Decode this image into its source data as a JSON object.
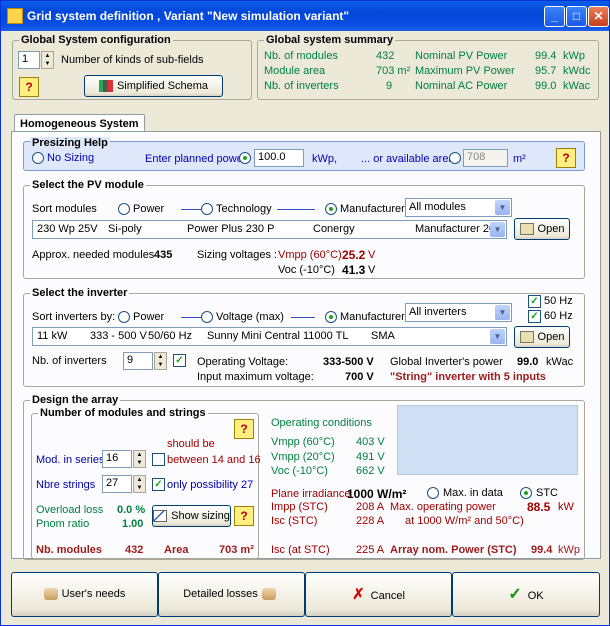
{
  "window": {
    "title": "Grid system definition , Variant  \"New simulation variant\"",
    "min": "_",
    "max": "□",
    "close": "✕"
  },
  "global_config": {
    "title": "Global System configuration",
    "subfields_value": "1",
    "subfields_label": "Number of kinds of sub-fields",
    "help": "?",
    "schema_button": "Simplified Schema"
  },
  "summary": {
    "title": "Global system summary",
    "rows": [
      {
        "label": "Nb. of modules",
        "value": "432",
        "label2": "Nominal PV Power",
        "value2": "99.4",
        "unit2": "kWp"
      },
      {
        "label": "Module area",
        "value": "703 m²",
        "label2": "Maximum PV Power",
        "value2": "95.7",
        "unit2": "kWdc"
      },
      {
        "label": "Nb. of inverters",
        "value": "9",
        "label2": "Nominal AC Power",
        "value2": "99.0",
        "unit2": "kWac"
      }
    ]
  },
  "tab": "Homogeneous System",
  "presizing": {
    "title": "Presizing Help",
    "no_sizing": "No Sizing",
    "planned_label": "Enter planned power",
    "planned_value": "100.0",
    "planned_unit": "kWp,",
    "area_label": "... or available area",
    "area_value": "708",
    "area_unit": "m²",
    "help": "?"
  },
  "pv": {
    "title": "Select the PV module",
    "sort_label": "Sort modules",
    "opt_power": "Power",
    "opt_tech": "Technology",
    "opt_manu": "Manufacturer",
    "filter": "All modules",
    "module": {
      "c1": "230 Wp 25V",
      "c2": "Si-poly",
      "c3": "Power Plus 230 P",
      "c4": "Conergy",
      "c5": "Manufacturer 20("
    },
    "open": "Open",
    "approx_label": "Approx. needed modules",
    "approx_value": "435",
    "sizing_label": "Sizing voltages :",
    "vmpp_label": "Vmpp (60°C)",
    "vmpp_value": "25.2",
    "vmpp_unit": "V",
    "voc_label": "Voc  (-10°C)",
    "voc_value": "41.3",
    "voc_unit": "V"
  },
  "inverter": {
    "title": "Select the inverter",
    "sort_label": "Sort inverters by:",
    "opt_power": "Power",
    "opt_voltage": "Voltage (max)",
    "opt_manu": "Manufacturer",
    "filter": "All inverters",
    "hz50": "50 Hz",
    "hz60": "60 Hz",
    "inv": {
      "c1": "11 kW",
      "c2": "333 - 500 V",
      "c3": "50/60 Hz",
      "c4": "Sunny Mini Central 11000 TL",
      "c5": "SMA"
    },
    "open": "Open",
    "nb_label": "Nb. of inverters",
    "nb_value": "9",
    "opv_label": "Operating Voltage:",
    "opv_value": "333-500 V",
    "max_in_label": "Input maximum voltage:",
    "max_in_value": "700 V",
    "global_label": "Global Inverter's power",
    "global_value": "99.0",
    "global_unit": "kWac",
    "string_note": "\"String\" inverter with 5 inputs"
  },
  "array": {
    "title": "Design the array",
    "ms_title": "Number of modules and strings",
    "help": "?",
    "should_be": "should be",
    "series_label": "Mod. in series",
    "series_value": "16",
    "between": "between 14 and 16",
    "strings_label": "Nbre strings",
    "strings_value": "27",
    "only": "only possibility 27",
    "overload_label": "Overload loss",
    "overload_value": "0.0 %",
    "pnom_label": "Pnom ratio",
    "pnom_value": "1.00",
    "show_sizing": "Show sizing",
    "help2": "?",
    "nb_mod_label": "Nb. modules",
    "nb_mod_value": "432",
    "area_label": "Area",
    "area_value": "703 m²",
    "op_title": "Operating conditions",
    "vmpp60_label": "Vmpp (60°C)",
    "vmpp60_value": "403 V",
    "vmpp20_label": "Vmpp (20°C)",
    "vmpp20_value": "491 V",
    "voc_label": "Voc  (-10°C)",
    "voc_value": "662 V",
    "irr_label": "Plane irradiance",
    "irr_value": "1000 W/m²",
    "maxdata": "Max. in data",
    "stc": "STC",
    "impp_label": "Impp (STC)",
    "impp_value": "208 A",
    "maxop_label": "Max. operating power",
    "maxop_value": "88.5",
    "maxop_unit": "kW",
    "isc_label": "Isc  (STC)",
    "isc_value": "228 A",
    "at_label": "at 1000 W/m² and 50°C)",
    "iscat_label": "Isc (at STC)",
    "iscat_value": "225 A",
    "nom_label": "Array nom. Power (STC)",
    "nom_value": "99.4",
    "nom_unit": "kWp"
  },
  "bottom": {
    "users": "User's needs",
    "losses": "Detailed losses",
    "cancel": "Cancel",
    "ok": "OK"
  }
}
